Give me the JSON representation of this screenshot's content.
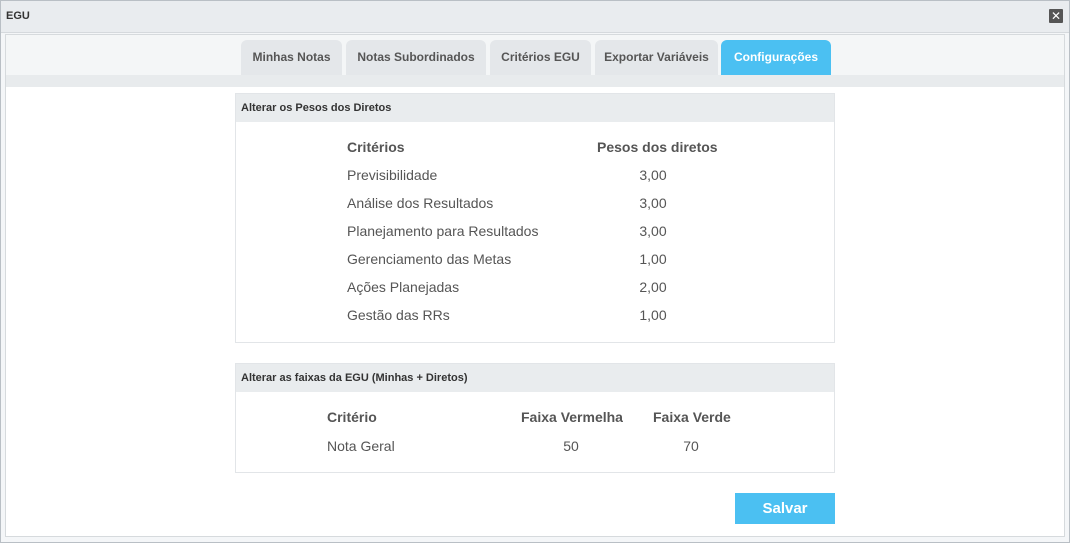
{
  "window": {
    "title": "EGU",
    "close_label": "✕"
  },
  "tabs": [
    {
      "label": "Minhas Notas"
    },
    {
      "label": "Notas Subordinados"
    },
    {
      "label": "Critérios EGU"
    },
    {
      "label": "Exportar Variáveis"
    },
    {
      "label": "Configurações",
      "active": true
    }
  ],
  "pesos": {
    "header": "Alterar os Pesos dos Diretos",
    "columns": [
      "Critérios",
      "Pesos dos diretos"
    ],
    "rows": [
      {
        "criterio": "Previsibilidade",
        "peso": "3,00"
      },
      {
        "criterio": "Análise dos Resultados",
        "peso": "3,00"
      },
      {
        "criterio": "Planejamento para Resultados",
        "peso": "3,00"
      },
      {
        "criterio": "Gerenciamento das Metas",
        "peso": "1,00"
      },
      {
        "criterio": "Ações Planejadas",
        "peso": "2,00"
      },
      {
        "criterio": "Gestão das RRs",
        "peso": "1,00"
      }
    ]
  },
  "faixas": {
    "header": "Alterar as faixas da EGU (Minhas + Diretos)",
    "columns": [
      "Critério",
      "Faixa Vermelha",
      "Faixa Verde"
    ],
    "rows": [
      {
        "criterio": "Nota Geral",
        "vermelha": "50",
        "verde": "70"
      }
    ]
  },
  "actions": {
    "save_label": "Salvar"
  },
  "colors": {
    "accent": "#4bc0f2",
    "panel_header": "#e9ecee"
  }
}
